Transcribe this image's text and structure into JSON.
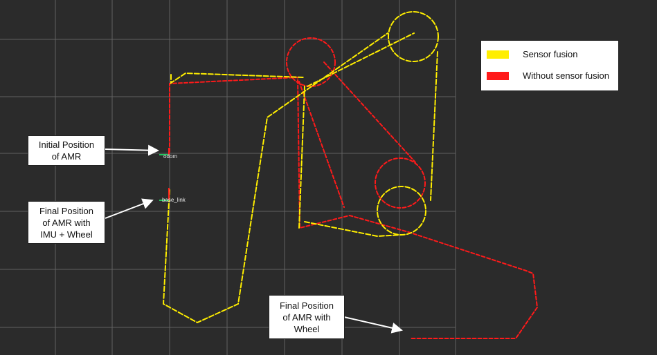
{
  "colors": {
    "background": "#2b2b2b",
    "grid": "#9a9a9a",
    "sensor_fusion": "#ffee00",
    "without_sensor_fusion": "#ff1a1a",
    "frame_axis_green": "#22c55e",
    "frame_axis_red": "#ff2020"
  },
  "legend": {
    "items": [
      {
        "label": "Sensor fusion",
        "color": "#ffee00"
      },
      {
        "label": "Without sensor fusion",
        "color": "#ff1a1a"
      }
    ]
  },
  "callouts": {
    "initial_position": "Initial Position\nof AMR",
    "final_position_imu_wheel": "Final Position\nof AMR with\nIMU + Wheel",
    "final_position_wheel": "Final Position\nof AMR with\nWheel"
  },
  "frames": {
    "odom_label": "odom",
    "base_label": "base_link"
  },
  "icons": {
    "arrow": "arrow-icon",
    "frame_axes": "axes-icon"
  }
}
